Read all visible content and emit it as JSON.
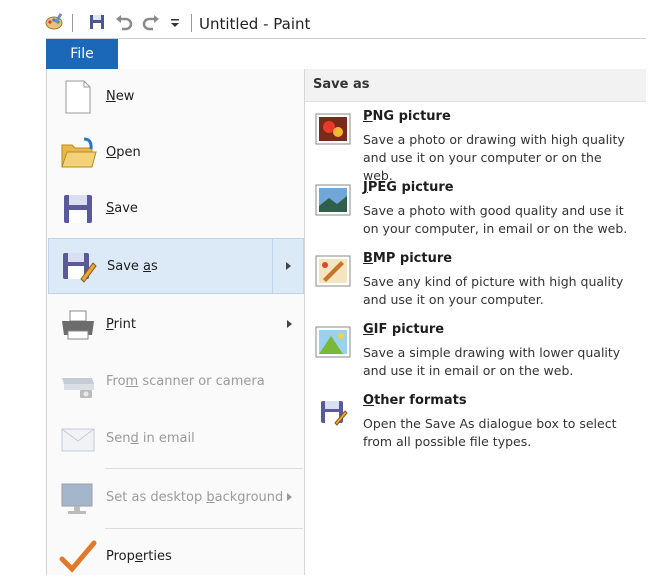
{
  "window": {
    "title": "Untitled - Paint"
  },
  "quick_access": {
    "icons": [
      "paint-app-icon",
      "save-icon",
      "undo-icon",
      "redo-icon",
      "customize-dropdown-icon"
    ]
  },
  "file_tab": {
    "label": "File"
  },
  "menu": {
    "items": [
      {
        "label": "New",
        "accel": "N",
        "icon": "new-document-icon"
      },
      {
        "label": "Open",
        "accel": "O",
        "icon": "open-folder-icon"
      },
      {
        "label": "Save",
        "accel": "S",
        "icon": "save-disk-icon"
      },
      {
        "label": "Save as",
        "accel": "a",
        "icon": "save-as-icon",
        "active": true
      },
      {
        "label": "Print",
        "accel": "P",
        "icon": "printer-icon"
      },
      {
        "label": "From scanner or camera",
        "accel": "m",
        "icon": "scanner-icon",
        "disabled": true
      },
      {
        "label": "Send in email",
        "accel": "d",
        "icon": "email-icon",
        "disabled": true
      },
      {
        "label": "Set as desktop background",
        "accel": "b",
        "icon": "desktop-icon",
        "disabled": true
      },
      {
        "label": "Properties",
        "accel": "e",
        "icon": "checkmark-icon"
      }
    ]
  },
  "save_as_panel": {
    "title": "Save as",
    "options": [
      {
        "title": "PNG picture",
        "desc": "Save a photo or drawing with high quality and use it on your computer or on the web.",
        "icon": "png-picture-icon"
      },
      {
        "title": "JPEG picture",
        "desc": "Save a photo with good quality and use it on your computer, in email or on the web.",
        "icon": "jpeg-picture-icon"
      },
      {
        "title": "BMP picture",
        "desc": "Save any kind of picture with high quality and use it on your computer.",
        "icon": "bmp-picture-icon"
      },
      {
        "title": "GIF picture",
        "desc": "Save a simple drawing with lower quality and use it in email or on the web.",
        "icon": "gif-picture-icon"
      },
      {
        "title": "Other formats",
        "desc": "Open the Save As dialogue box to select from all possible file types.",
        "icon": "other-formats-icon"
      }
    ]
  },
  "colors": {
    "file_tab": "#1c68b8",
    "active_item": "#dce9f7",
    "disabled_text": "#9b9b9b"
  }
}
